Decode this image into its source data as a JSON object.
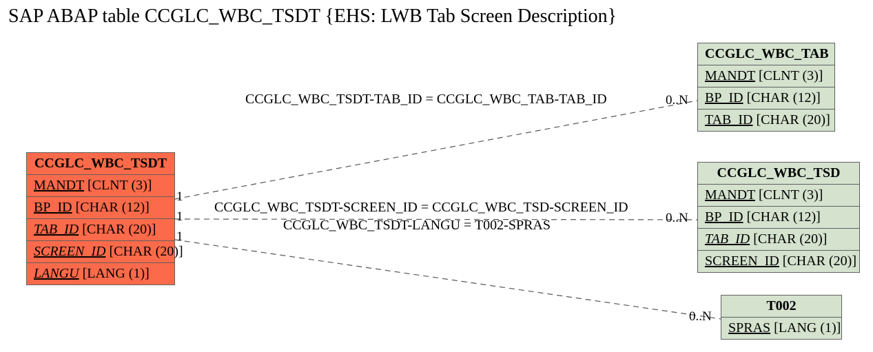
{
  "title": "SAP ABAP table CCGLC_WBC_TSDT {EHS: LWB Tab Screen Description}",
  "entities": {
    "main": {
      "name": "CCGLC_WBC_TSDT",
      "fields": [
        {
          "name": "MANDT",
          "type": "[CLNT (3)]",
          "u": true,
          "i": false
        },
        {
          "name": "BP_ID",
          "type": "[CHAR (12)]",
          "u": true,
          "i": false
        },
        {
          "name": "TAB_ID",
          "type": "[CHAR (20)]",
          "u": true,
          "i": true
        },
        {
          "name": "SCREEN_ID",
          "type": "[CHAR (20)]",
          "u": true,
          "i": true
        },
        {
          "name": "LANGU",
          "type": "[LANG (1)]",
          "u": true,
          "i": true
        }
      ]
    },
    "tab": {
      "name": "CCGLC_WBC_TAB",
      "fields": [
        {
          "name": "MANDT",
          "type": "[CLNT (3)]",
          "u": true,
          "i": false
        },
        {
          "name": "BP_ID",
          "type": "[CHAR (12)]",
          "u": true,
          "i": false
        },
        {
          "name": "TAB_ID",
          "type": "[CHAR (20)]",
          "u": true,
          "i": false
        }
      ]
    },
    "tsd": {
      "name": "CCGLC_WBC_TSD",
      "fields": [
        {
          "name": "MANDT",
          "type": "[CLNT (3)]",
          "u": true,
          "i": false
        },
        {
          "name": "BP_ID",
          "type": "[CHAR (12)]",
          "u": true,
          "i": false
        },
        {
          "name": "TAB_ID",
          "type": "[CHAR (20)]",
          "u": true,
          "i": true
        },
        {
          "name": "SCREEN_ID",
          "type": "[CHAR (20)]",
          "u": true,
          "i": false
        }
      ]
    },
    "t002": {
      "name": "T002",
      "fields": [
        {
          "name": "SPRAS",
          "type": "[LANG (1)]",
          "u": true,
          "i": false
        }
      ]
    }
  },
  "relations": {
    "r1": "CCGLC_WBC_TSDT-TAB_ID = CCGLC_WBC_TAB-TAB_ID",
    "r2": "CCGLC_WBC_TSDT-SCREEN_ID = CCGLC_WBC_TSD-SCREEN_ID",
    "r3": "CCGLC_WBC_TSDT-LANGU = T002-SPRAS"
  },
  "card": {
    "one": "1",
    "many": "0..N"
  }
}
